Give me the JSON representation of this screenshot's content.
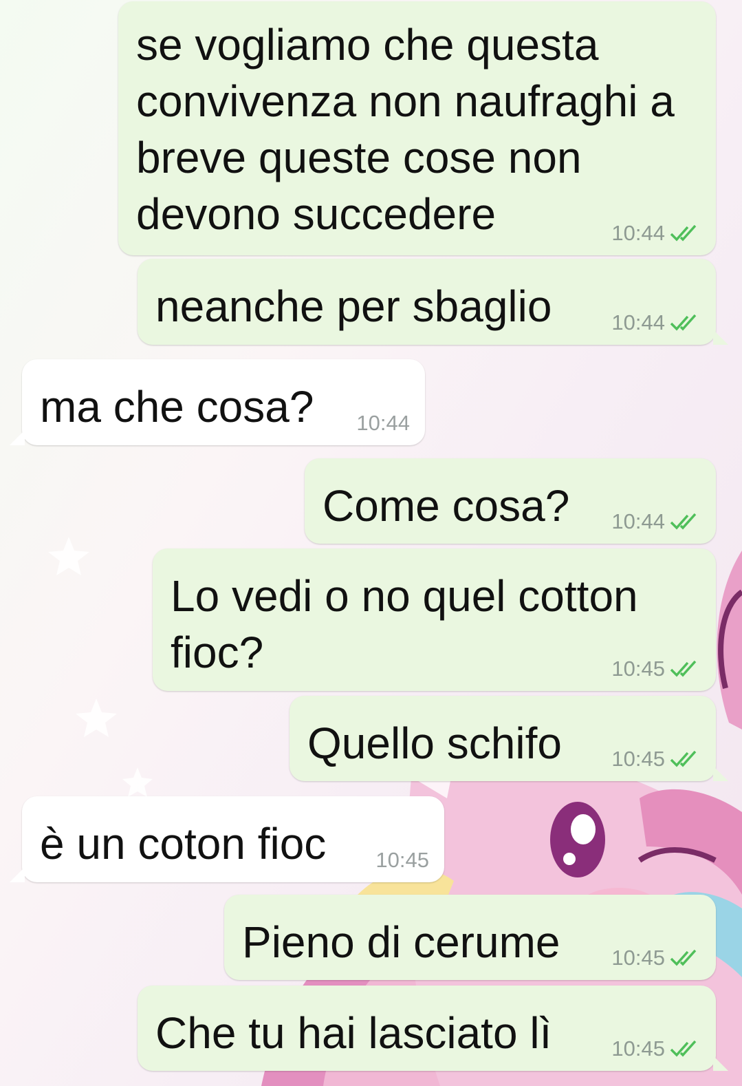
{
  "chat": {
    "messages": [
      {
        "id": 1,
        "direction": "outgoing",
        "text": "se vogliamo che questa convivenza non naufraghi a breve queste cose non devono succedere",
        "time": "10:44",
        "status": "read"
      },
      {
        "id": 2,
        "direction": "outgoing",
        "text": "neanche per sbaglio",
        "time": "10:44",
        "status": "read"
      },
      {
        "id": 3,
        "direction": "incoming",
        "text": "ma che cosa?",
        "time": "10:44"
      },
      {
        "id": 4,
        "direction": "outgoing",
        "text": "Come cosa?",
        "time": "10:44",
        "status": "read"
      },
      {
        "id": 5,
        "direction": "outgoing",
        "text": "Lo vedi o no quel cotton fioc?",
        "time": "10:45",
        "status": "read"
      },
      {
        "id": 6,
        "direction": "outgoing",
        "text": "Quello schifo",
        "time": "10:45",
        "status": "read"
      },
      {
        "id": 7,
        "direction": "incoming",
        "text": "è un coton fioc",
        "time": "10:45"
      },
      {
        "id": 8,
        "direction": "outgoing",
        "text": "Pieno di cerume",
        "time": "10:45",
        "status": "read"
      },
      {
        "id": 9,
        "direction": "outgoing",
        "text": "Che tu hai lasciato lì",
        "time": "10:45",
        "status": "read"
      }
    ]
  },
  "theme": {
    "outgoing_bubble": "#eaf7e0",
    "incoming_bubble": "#ffffff",
    "read_tick_color": "#4fbf5a",
    "wallpaper": "pink-unicorn-pastel"
  },
  "icons": {
    "read_status": "double-check-icon"
  }
}
